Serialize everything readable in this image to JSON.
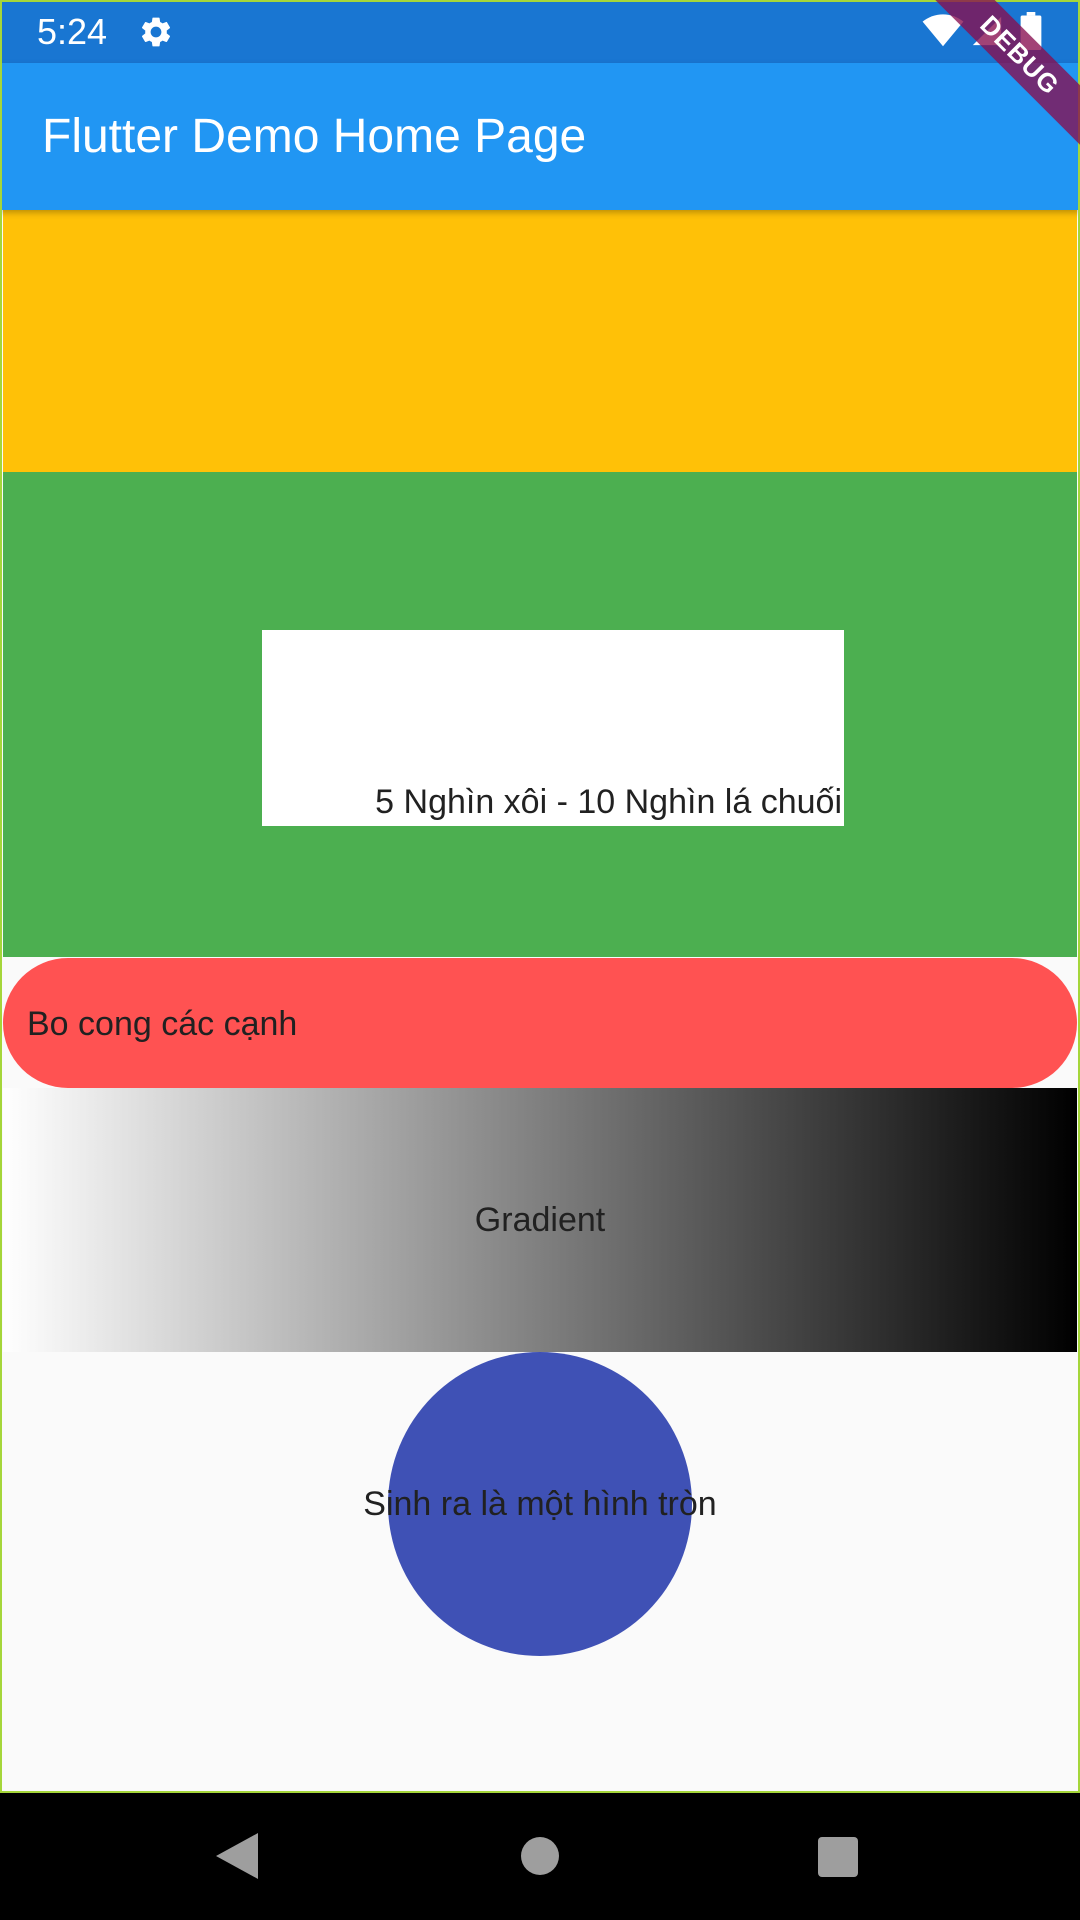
{
  "status_bar": {
    "time": "5:24",
    "icons": [
      "gear-icon",
      "wifi-icon",
      "signal-icon",
      "battery-icon"
    ],
    "background": "#1976d2"
  },
  "app_bar": {
    "title": "Flutter Demo Home Page",
    "background": "#2196f3"
  },
  "debug_banner": {
    "label": "DEBUG"
  },
  "sections": {
    "amber": {
      "color": "#ffc107"
    },
    "green": {
      "color": "#4caf50",
      "inner_text": "5 Nghìn xôi - 10 Nghìn lá chuối"
    },
    "rounded": {
      "color": "#ff5252",
      "text": "Bo cong các cạnh"
    },
    "gradient": {
      "colors": [
        "#ffffff",
        "#000000"
      ],
      "text": "Gradient"
    },
    "circle": {
      "color": "#3f51b5",
      "text": "Sinh ra là một hình tròn"
    }
  },
  "nav_bar": {
    "icons": [
      "back-icon",
      "home-icon",
      "recent-apps-icon"
    ]
  }
}
